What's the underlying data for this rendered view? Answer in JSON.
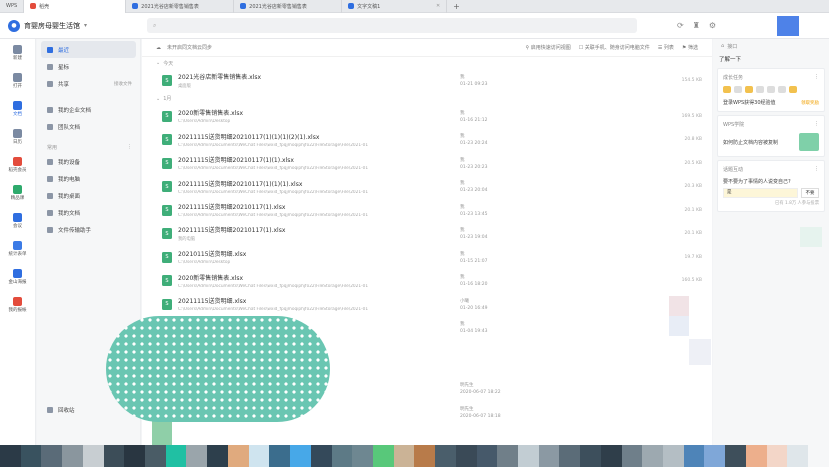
{
  "tabs": [
    {
      "label": "WPS",
      "icon": "wps-logo-icon"
    },
    {
      "label": "稻壳",
      "icon": "docer-icon"
    },
    {
      "label": "2021光谷店新零售销售表",
      "icon": "sheet-icon"
    },
    {
      "label": "2021光谷店新零售销售表",
      "icon": "sheet-icon"
    },
    {
      "label": "文字文稿1",
      "icon": "doc-icon"
    }
  ],
  "header": {
    "workspace": "育婴房母婴生活馆",
    "search_placeholder": ""
  },
  "rail": [
    {
      "label": "新建"
    },
    {
      "label": "打开"
    },
    {
      "label": "文档"
    },
    {
      "label": "日历"
    },
    {
      "label": "稻壳会员"
    },
    {
      "label": "精品课"
    },
    {
      "label": "会议"
    },
    {
      "label": "统计表单"
    },
    {
      "label": "金山海报"
    },
    {
      "label": "我的报帐"
    }
  ],
  "side": {
    "items_top": [
      {
        "label": "最近",
        "active": true
      },
      {
        "label": "星标"
      },
      {
        "label": "共享",
        "extra": "接收文件"
      }
    ],
    "items_team": [
      {
        "label": "我的企业文档"
      },
      {
        "label": "团队文档"
      }
    ],
    "section_label": "常用",
    "items_common": [
      {
        "label": "我的设备"
      },
      {
        "label": "我的电脑"
      },
      {
        "label": "我的桌面"
      },
      {
        "label": "我的文档"
      },
      {
        "label": "文件传输助手"
      }
    ],
    "recycle": "回收站"
  },
  "toolbar": {
    "sync": "未开启同文档云同步",
    "quick": "启用快速访问视图",
    "check": "关联手机、随身访问电脑文件",
    "list": "列表",
    "filter": "筛选"
  },
  "groups": {
    "today": "今天",
    "month": "1月"
  },
  "files_today": [
    {
      "name": "2021光谷店新零售销售表.xlsx",
      "path": "桌面版",
      "owner": "我",
      "date": "01-21 09:23",
      "size": "154.5 KB"
    }
  ],
  "files_month": [
    {
      "name": "2020新零售销售表.xlsx",
      "path": "C:\\Users\\Admin\\Desktop",
      "owner": "我",
      "date": "01-16 21:12",
      "size": "169.5 KB"
    },
    {
      "name": "20211115送货明细20210117(1)(1)(1)(2)(1).xlsx",
      "path": "C:\\Users\\Admin\\Documents\\WeChat Files\\wxid_fpqjmoqiphjfo22\\FileStorage\\File\\2021-01",
      "owner": "我",
      "date": "01-23 20:24",
      "size": "20.8 KB"
    },
    {
      "name": "20211115送货明细20210117(1)(1).xlsx",
      "path": "C:\\Users\\Admin\\Documents\\WeChat Files\\wxid_fpqjmoqiphjfo22\\FileStorage\\File\\2021-01",
      "owner": "我",
      "date": "01-23 20:23",
      "size": "20.5 KB"
    },
    {
      "name": "20211115送货明细20210117(1)(1)(1).xlsx",
      "path": "C:\\Users\\Admin\\Documents\\WeChat Files\\wxid_fpqjmoqiphjfo22\\FileStorage\\File\\2021-01",
      "owner": "我",
      "date": "01-23 20:04",
      "size": "20.3 KB"
    },
    {
      "name": "20211115送货明细20210117(1).xlsx",
      "path": "C:\\Users\\Admin\\Documents\\WeChat Files\\wxid_fpqjmoqiphjfo22\\FileStorage\\File\\2021-01",
      "owner": "我",
      "date": "01-23 13:45",
      "size": "20.1 KB"
    },
    {
      "name": "20211115送货明细20210117(1).xlsx",
      "path": "我的电脑",
      "owner": "我",
      "date": "01-23 19:04",
      "size": "20.1 KB"
    },
    {
      "name": "20210115送货明细.xlsx",
      "path": "C:\\Users\\Admin\\Desktop",
      "owner": "我",
      "date": "01-15 21:07",
      "size": "19.7 KB"
    },
    {
      "name": "2020新零售销售表.xlsx",
      "path": "C:\\Users\\Admin\\Documents\\WeChat Files\\wxid_fpqjmoqiphjfo22\\FileStorage\\File\\2021-01",
      "owner": "我",
      "date": "01-16 18:20",
      "size": "160.5 KB"
    },
    {
      "name": "20211115送货明细.xlsx",
      "path": "C:\\Users\\Admin\\Documents\\WeChat Files\\wxid_fpqjmoqiphjfo22\\FileStorage\\File\\2021-01",
      "owner": "小曦",
      "date": "01-20 16:49",
      "size": ""
    },
    {
      "name": "",
      "path": "",
      "owner": "我",
      "date": "01-04 19:43",
      "size": ""
    }
  ],
  "files_bottom": [
    {
      "owner": "明先生",
      "date": "2020-06-07 18:22"
    },
    {
      "owner": "明先生",
      "date": "2020-06-07 18:18"
    }
  ],
  "rpanel": {
    "top": "接口",
    "learn": "了解一下",
    "task_title": "成长任务",
    "task_body": "登录WPS获得30经验值",
    "task_ok": "领取奖励",
    "class_title": "WPS学院",
    "class_body": "如何防止文档内容被复制",
    "ask_title": "话题互动",
    "ask_body": "要不要为了事情的人说变自己?",
    "ask_input": "是",
    "ask_btn": "不要",
    "ask_meta": "已有 1.8万 人参与投票"
  }
}
